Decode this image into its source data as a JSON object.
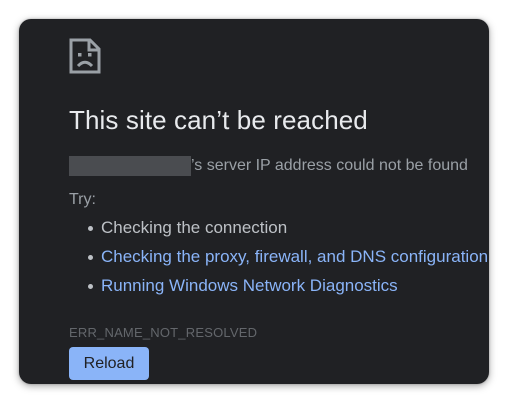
{
  "page": {
    "icon": "sad-face-document-icon",
    "title": "This site can’t be reached",
    "subtitle_suffix": "’s server IP address could not be found",
    "try_label": "Try:",
    "suggestions": [
      {
        "text": "Checking the connection",
        "is_link": false
      },
      {
        "text": "Checking the proxy, firewall, and DNS configuration",
        "is_link": true
      },
      {
        "text": "Running Windows Network Diagnostics",
        "is_link": true
      }
    ],
    "error_code": "ERR_NAME_NOT_RESOLVED",
    "reload_label": "Reload"
  },
  "colors": {
    "background": "#202124",
    "title": "#e8eaed",
    "text": "#9aa0a6",
    "link": "#8ab4f8",
    "button": "#8ab4f8"
  }
}
